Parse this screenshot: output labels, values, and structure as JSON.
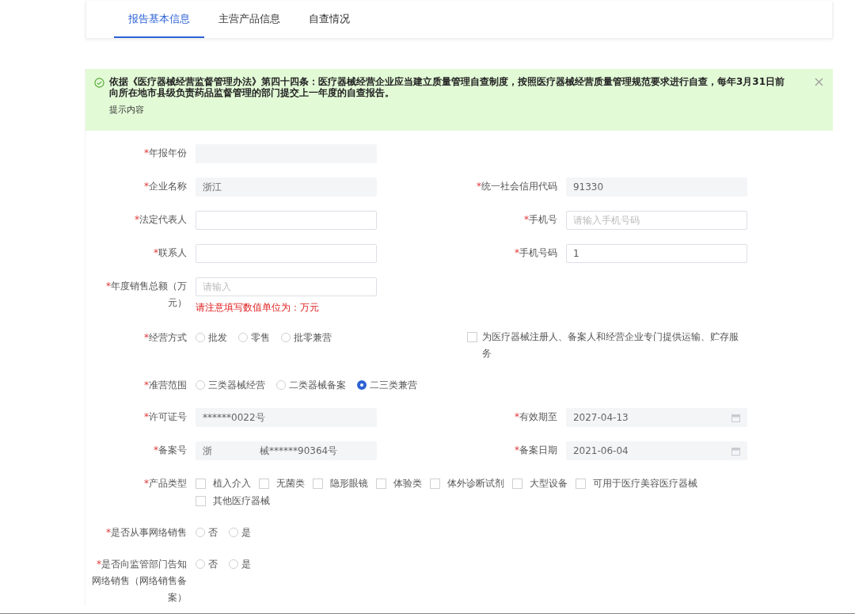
{
  "tabs": [
    {
      "label": "报告基本信息",
      "selected": true
    },
    {
      "label": "主营产品信息",
      "selected": false
    },
    {
      "label": "自查情况",
      "selected": false
    }
  ],
  "alert": {
    "message": "依据《医疗器械经营监督管理办法》第四十四条：医疗器械经营企业应当建立质量管理自查制度，按照医疗器械经营质量管理规范要求进行自查，每年3月31日前向所在地市县级负责药品监督管理的部门提交上一年度的自查报告。",
    "description": "提示内容",
    "closable": true
  },
  "form": {
    "required_mark": "*",
    "rows": [
      {
        "left": {
          "kind": "readonly",
          "label": "年报年份",
          "required": true
        }
      },
      {
        "left": {
          "kind": "readonly",
          "label": "企业名称",
          "required": true,
          "value": "浙江"
        },
        "right": {
          "kind": "readonly",
          "label": "统一社会信用代码",
          "required": true,
          "value": "91330"
        }
      },
      {
        "left": {
          "kind": "input",
          "label": "法定代表人",
          "required": true
        },
        "right": {
          "kind": "input",
          "label": "手机号",
          "required": true,
          "placeholder": "请输入手机号码"
        }
      },
      {
        "left": {
          "kind": "input",
          "label": "联系人",
          "required": true
        },
        "right": {
          "kind": "input",
          "label": "手机号码",
          "required": true,
          "value": "1"
        }
      },
      {
        "left": {
          "kind": "input",
          "label": "年度销售总额（万元）",
          "required": true,
          "placeholder": "请输入",
          "error": "请注意填写数值单位为：万元"
        }
      },
      {
        "left": {
          "kind": "radio",
          "label": "经营方式",
          "required": true,
          "options": [
            {
              "label": "批发",
              "selected": false
            },
            {
              "label": "零售",
              "selected": false
            },
            {
              "label": "批零兼营",
              "selected": false
            }
          ]
        },
        "right": {
          "kind": "checkbox",
          "label": "为医疗器械注册人、备案人和经营企业专门提供运输、贮存服务",
          "checked": false
        }
      },
      {
        "left": {
          "kind": "radio",
          "label": "准营范围",
          "required": true,
          "options": [
            {
              "label": "三类器械经营",
              "selected": false
            },
            {
              "label": "二类器械备案",
              "selected": false
            },
            {
              "label": "二三类兼营",
              "selected": true
            }
          ]
        }
      },
      {
        "left": {
          "kind": "readonly",
          "label": "许可证号",
          "required": true,
          "value": "******0022号"
        },
        "right": {
          "kind": "date",
          "label": "有效期至",
          "required": true,
          "value": "2027-04-13"
        }
      },
      {
        "left": {
          "kind": "readonly",
          "label": "备案号",
          "required": true,
          "value": "浙",
          "value_tail": "械******90364号"
        },
        "right": {
          "kind": "date",
          "label": "备案日期",
          "required": true,
          "value": "2021-06-04"
        }
      },
      {
        "left": {
          "kind": "checkgroup",
          "label": "产品类型",
          "required": true,
          "options": [
            {
              "label": "植入介入",
              "checked": false
            },
            {
              "label": "无菌类",
              "checked": false
            },
            {
              "label": "隐形眼镜",
              "checked": false
            },
            {
              "label": "体验类",
              "checked": false
            },
            {
              "label": "体外诊断试剂",
              "checked": false
            },
            {
              "label": "大型设备",
              "checked": false
            },
            {
              "label": "可用于医疗美容医疗器械",
              "checked": false
            },
            {
              "label": "其他医疗器械",
              "checked": false
            }
          ]
        }
      },
      {
        "left": {
          "kind": "radio",
          "label": "是否从事网络销售",
          "required": true,
          "options": [
            {
              "label": "否",
              "selected": false
            },
            {
              "label": "是",
              "selected": false
            }
          ]
        }
      },
      {
        "left": {
          "kind": "radio",
          "label": "是否向监管部门告知网络销售（网络销售备案）",
          "required": true,
          "options": [
            {
              "label": "否",
              "selected": false
            },
            {
              "label": "是",
              "selected": false
            }
          ]
        }
      }
    ]
  }
}
